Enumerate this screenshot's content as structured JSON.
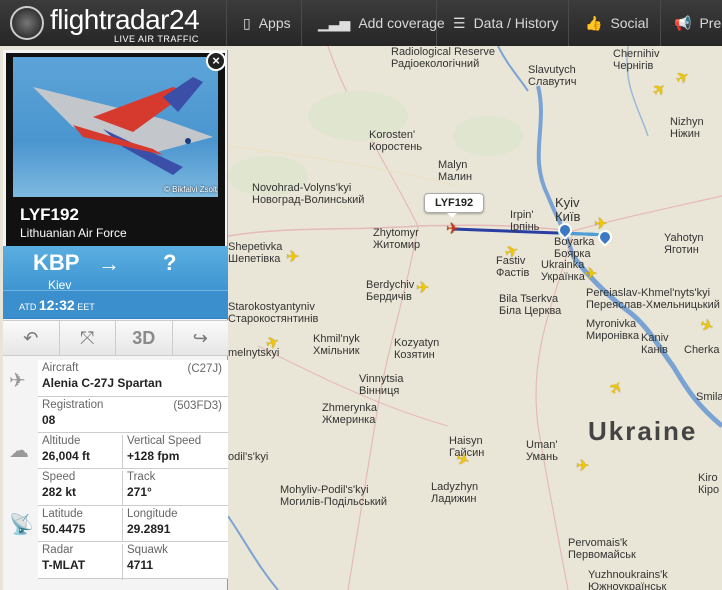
{
  "brand": {
    "name": "flightradar24",
    "tagline": "LIVE AIR TRAFFIC"
  },
  "nav": [
    {
      "label": "Apps",
      "icon": "phone-icon"
    },
    {
      "label": "Add coverage",
      "icon": "signal-bars-icon"
    },
    {
      "label": "Data / History",
      "icon": "database-icon"
    },
    {
      "label": "Social",
      "icon": "thumbs-up-icon"
    },
    {
      "label": "Pre",
      "icon": "megaphone-icon"
    }
  ],
  "flight": {
    "photo_credit": "© Bikfalvi Zsolt",
    "callsign": "LYF192",
    "airline": "Lithuanian Air Force",
    "from_code": "KBP",
    "from_city": "Kiev",
    "to_code": "?",
    "atd_label": "ATD",
    "atd_time": "12:32",
    "atd_zone": "EET",
    "tool_3d": "3D"
  },
  "details": {
    "aircraft_label": "Aircraft",
    "aircraft_code": "(C27J)",
    "aircraft_value": "Alenia C-27J Spartan",
    "registration_label": "Registration",
    "registration_code": "(503FD3)",
    "registration_value": "08",
    "altitude_label": "Altitude",
    "altitude_value": "26,004 ft",
    "vspeed_label": "Vertical Speed",
    "vspeed_value": "+128 fpm",
    "speed_label": "Speed",
    "speed_value": "282 kt",
    "track_label": "Track",
    "track_value": "271°",
    "lat_label": "Latitude",
    "lat_value": "50.4475",
    "lon_label": "Longitude",
    "lon_value": "29.2891",
    "radar_label": "Radar",
    "radar_value": "T-MLAT",
    "squawk_label": "Squawk",
    "squawk_value": "4711"
  },
  "map": {
    "callout": "LYF192",
    "country": "Ukraine",
    "reserve": "Radiological Reserve\nРадіоекологічний",
    "cities": {
      "chernihiv": "Chernihiv\nЧернігів",
      "slavutych": "Slavutych\nСлавутич",
      "nizhyn": "Nizhyn\nНіжин",
      "korosten": "Korosten'\nКоростень",
      "malyn": "Malyn\nМалин",
      "novohrad": "Novohrad-Volyns'kyi\nНовоград-Волинський",
      "irpin": "Irpin'\nІрпінь",
      "kyiv": "Kyiv\nКиїв",
      "zhytomyr": "Zhytomyr\nЖитомир",
      "boyarka": "Boyarka\nБоярка",
      "yahotyn": "Yahotyn\nЯготин",
      "shepetivka": "Shepetivka\nШепетівка",
      "fastiv": "Fastiv\nФастів",
      "ukrainka": "Ukrainka\nУкраїнка",
      "berdychiv": "Berdychiv\nБердичів",
      "pereiaslav": "Pereiaslav-Khmel'nyts'kyi\nПереяслав-Хмельницький",
      "starokostiantyniv": "Starokostyantyniv\nСтарокостянтинів",
      "bilatserkva": "Bila Tserkva\nБіла Церква",
      "myronivka": "Myronivka\nМиронівка",
      "khmilnyk": "Khmil'nyk\nХмільник",
      "koziatyn": "Kozyatyn\nКозятин",
      "kaniv": "Kaniv\nКанів",
      "cherkasy": "Cherka",
      "khmelnytskyi": "melnytskyi",
      "vinnytsia": "Vinnytsia\nВінниця",
      "zhmerynka": "Zhmerynka\nЖмеринка",
      "smila": "Smila",
      "haisyn": "Haisyn\nГайсин",
      "uman": "Uman'\nУмань",
      "podilskyi": "odil's'kyi",
      "ladyzhyn": "Ladyzhyn\nЛадижин",
      "kirovohrad": "Kiro\nКіро",
      "mohyliv": "Mohyliv-Podil's'kyi\nМогилів-Подільський",
      "pervomaisk": "Pervomais'k\nПервомайськ",
      "yuzhnoukrainsk": "Yuzhnoukrains'k\nЮжноукраїнськ"
    }
  }
}
